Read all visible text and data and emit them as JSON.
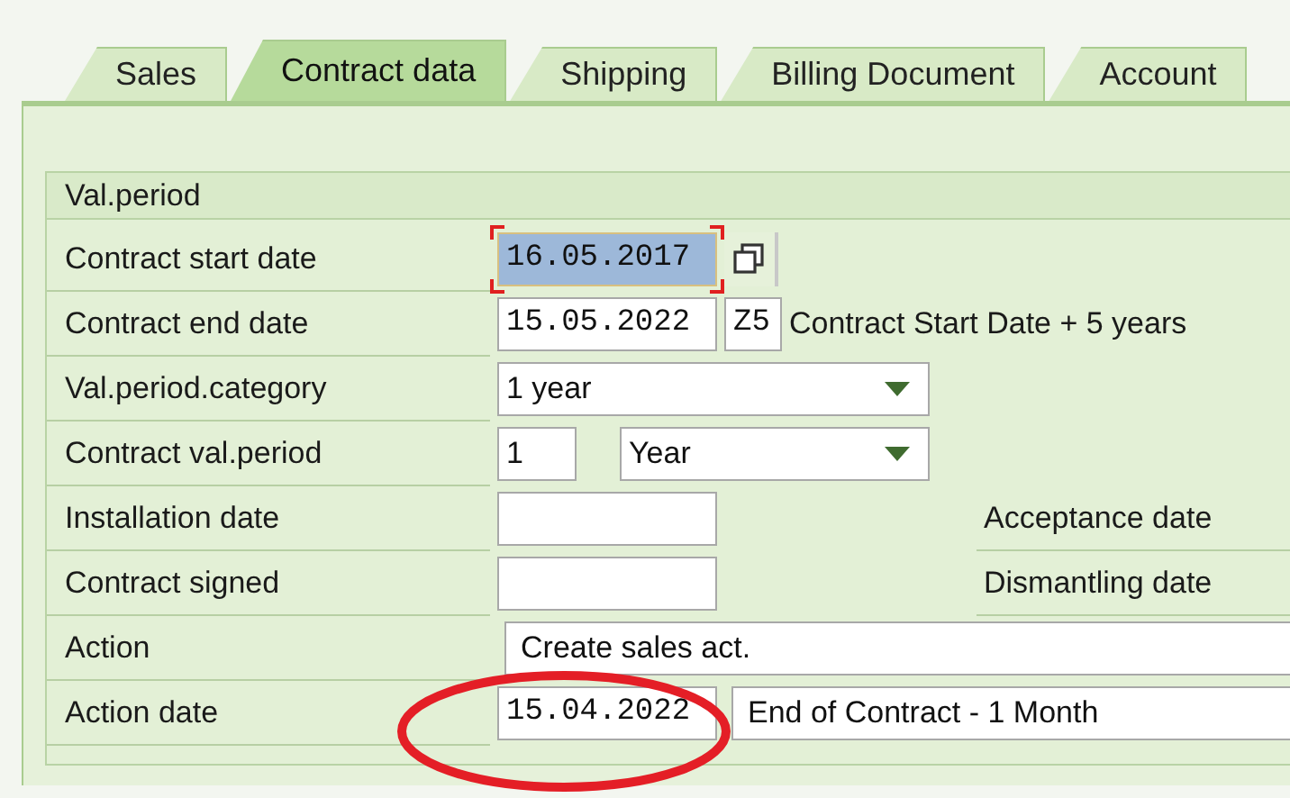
{
  "tabs": [
    {
      "label": "Sales",
      "selected": false
    },
    {
      "label": "Contract data",
      "selected": true
    },
    {
      "label": "Shipping",
      "selected": false
    },
    {
      "label": "Billing Document",
      "selected": false
    },
    {
      "label": "Account",
      "selected": false
    }
  ],
  "group": {
    "title": "Val.period",
    "rows": [
      {
        "label": "Contract start date",
        "fields": [
          {
            "kind": "date",
            "value": "16.05.2017",
            "focused": true
          },
          {
            "kind": "copy_button"
          }
        ]
      },
      {
        "label": "Contract end date",
        "fields": [
          {
            "kind": "date",
            "value": "15.05.2022",
            "focused": false
          },
          {
            "kind": "code",
            "value": "Z5"
          },
          {
            "kind": "note",
            "text": "Contract Start Date + 5 years"
          }
        ]
      },
      {
        "label": "Val.period.category",
        "fields": [
          {
            "kind": "dropdown",
            "value": "1 year"
          }
        ]
      },
      {
        "label": "Contract val.period",
        "fields": [
          {
            "kind": "number",
            "value": "1"
          },
          {
            "kind": "dropdown",
            "value": "Year"
          }
        ]
      },
      {
        "label": "Installation date",
        "fields": [
          {
            "kind": "date",
            "focused": false
          },
          {
            "kind": "side_label",
            "text": "Acceptance date"
          }
        ]
      },
      {
        "label": "Contract signed",
        "fields": [
          {
            "kind": "date",
            "focused": false
          },
          {
            "kind": "side_label",
            "text": "Dismantling date"
          }
        ]
      },
      {
        "label": "Action",
        "fields": [
          {
            "kind": "text",
            "value": "Create sales act."
          }
        ]
      },
      {
        "label": "Action date",
        "fields": [
          {
            "kind": "date",
            "value": "15.04.2022",
            "focused": false
          },
          {
            "kind": "text",
            "value": "End of Contract - 1 Month"
          }
        ]
      }
    ]
  }
}
